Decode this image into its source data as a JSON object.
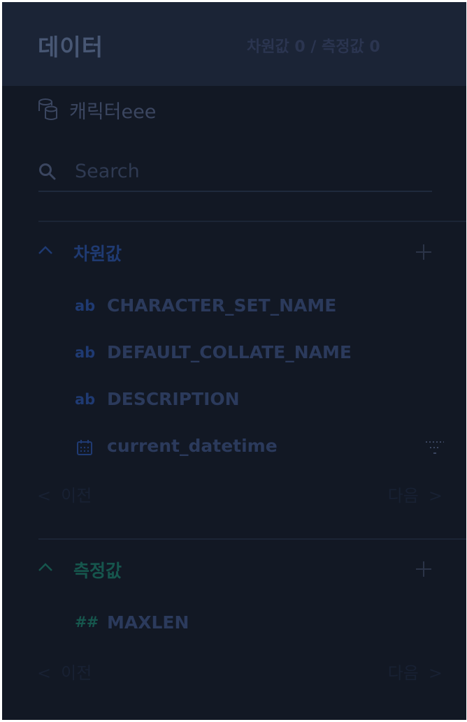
{
  "header": {
    "title": "데이터",
    "counts": "차원값 0 / 측정값 0"
  },
  "dataset": {
    "name": "캐릭터eee",
    "icon": "database-icon"
  },
  "search": {
    "placeholder": "Search",
    "value": ""
  },
  "dimensions": {
    "title": "차원값",
    "color": "#1f3a72",
    "fields": [
      {
        "type": "ab",
        "name": "CHARACTER_SET_NAME"
      },
      {
        "type": "ab",
        "name": "DEFAULT_COLLATE_NAME"
      },
      {
        "type": "ab",
        "name": "DESCRIPTION"
      },
      {
        "type": "date",
        "name": "current_datetime"
      }
    ],
    "pager": {
      "prev": "이전",
      "next": "다음"
    }
  },
  "measures": {
    "title": "측정값",
    "color": "#16564d",
    "fields": [
      {
        "type": "##",
        "name": "MAXLEN"
      }
    ],
    "pager": {
      "prev": "이전",
      "next": "다음"
    }
  }
}
